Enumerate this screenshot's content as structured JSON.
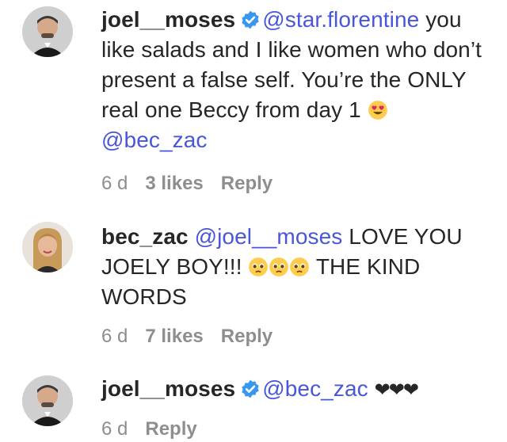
{
  "comments": [
    {
      "username": "joel__moses",
      "mention1": "@star.florentine",
      "text1": " you like salads and I like women who don’t present a false self. You’re the ONLY real one Beccy from day 1 ",
      "mention2": "@bec_zac",
      "time": "6 d",
      "likes": "3 likes",
      "reply": "Reply"
    },
    {
      "username": "bec_zac",
      "mention1": "@joel__moses",
      "text1": " LOVE YOU JOELY BOY!!! ",
      "text2": " THE KIND WORDS",
      "time": "6 d",
      "likes": "7 likes",
      "reply": "Reply"
    },
    {
      "username": "joel__moses",
      "mention1": "@bec_zac",
      "hearts": "❤❤❤",
      "time": "6 d",
      "reply": "Reply"
    }
  ],
  "icons": {
    "verified": "verified-badge-icon",
    "heart_eyes": "heart-eyes-emoji",
    "pleading": "pleading-face-emoji"
  },
  "colors": {
    "mention": "#4a56d8",
    "verified": "#3897f0",
    "meta": "#8e8e8e"
  }
}
